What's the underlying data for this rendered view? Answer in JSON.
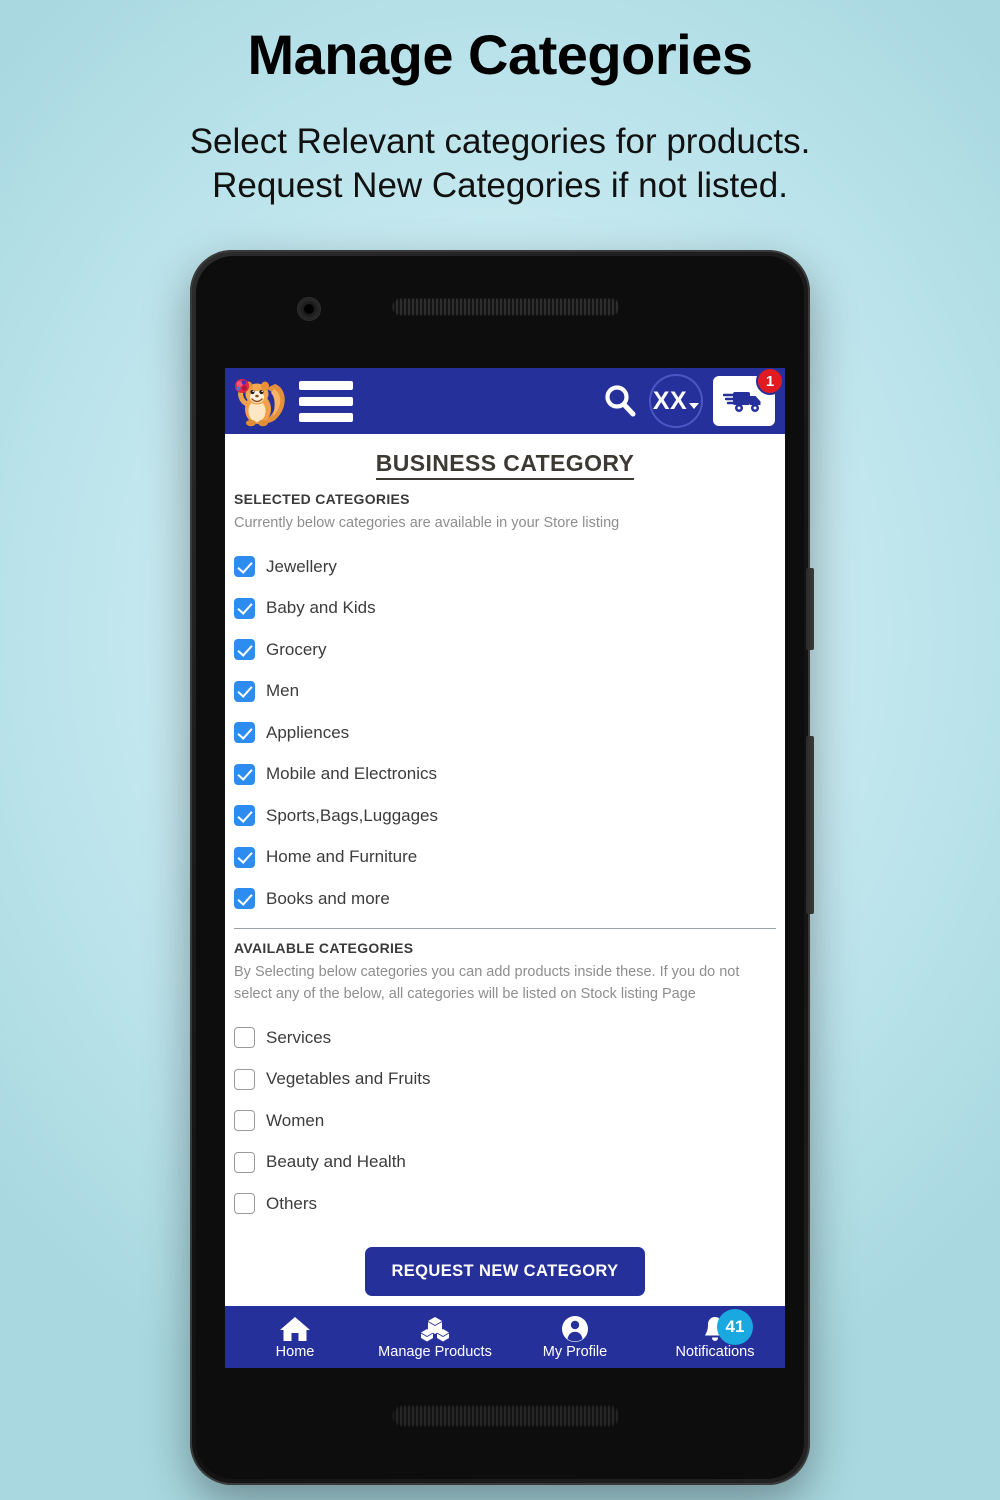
{
  "promo": {
    "title": "Manage Categories",
    "subtitle_line1": "Select Relevant categories for products.",
    "subtitle_line2": "Request New Categories if not listed."
  },
  "colors": {
    "brand_blue": "#26309a",
    "checkbox_blue": "#2d8cf0",
    "cart_badge_red": "#e01b22",
    "notification_badge_cyan": "#19a8e0",
    "page_background": "#bfe5ec"
  },
  "appbar": {
    "logo_icon": "squirrel-mascot-logo",
    "menu_icon": "hamburger-menu-icon",
    "search_icon": "search-icon",
    "language_selector": "XX",
    "language_caret_icon": "chevron-down-icon",
    "cart_icon": "delivery-truck-icon",
    "cart_badge": "1"
  },
  "page": {
    "title": "BUSINESS CATEGORY"
  },
  "selected_section": {
    "heading": "SELECTED CATEGORIES",
    "description": "Currently below categories are available in your Store listing",
    "items": [
      {
        "label": "Jewellery",
        "checked": true
      },
      {
        "label": "Baby and Kids",
        "checked": true
      },
      {
        "label": "Grocery",
        "checked": true
      },
      {
        "label": "Men",
        "checked": true
      },
      {
        "label": "Appliences",
        "checked": true
      },
      {
        "label": "Mobile and Electronics",
        "checked": true
      },
      {
        "label": "Sports,Bags,Luggages",
        "checked": true
      },
      {
        "label": "Home and Furniture",
        "checked": true
      },
      {
        "label": "Books and more",
        "checked": true
      }
    ]
  },
  "available_section": {
    "heading": "AVAILABLE CATEGORIES",
    "description": "By Selecting below categories you can add products inside these. If you do not select any of the below, all categories will be listed on Stock listing Page",
    "items": [
      {
        "label": "Services",
        "checked": false
      },
      {
        "label": "Vegetables and Fruits",
        "checked": false
      },
      {
        "label": "Women",
        "checked": false
      },
      {
        "label": "Beauty and Health",
        "checked": false
      },
      {
        "label": "Others",
        "checked": false
      }
    ]
  },
  "action": {
    "request_button": "REQUEST NEW CATEGORY"
  },
  "bottomnav": {
    "items": [
      {
        "label": "Home",
        "icon": "home-icon",
        "badge": ""
      },
      {
        "label": "Manage Products",
        "icon": "boxes-icon",
        "badge": ""
      },
      {
        "label": "My Profile",
        "icon": "user-account-icon",
        "badge": ""
      },
      {
        "label": "Notifications",
        "icon": "bell-icon",
        "badge": "41"
      }
    ]
  }
}
